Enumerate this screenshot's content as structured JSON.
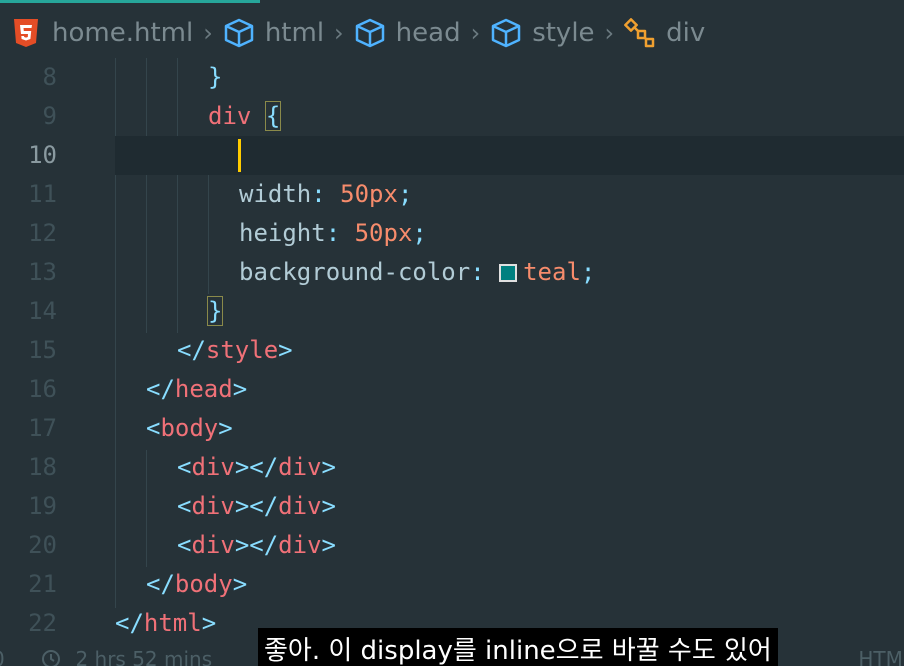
{
  "breadcrumb": {
    "file": "home.html",
    "items": [
      "html",
      "head",
      "style",
      "div"
    ],
    "separator": "›"
  },
  "editor": {
    "current_line": "10",
    "lines": [
      {
        "n": "8"
      },
      {
        "n": "9"
      },
      {
        "n": "10"
      },
      {
        "n": "11"
      },
      {
        "n": "12"
      },
      {
        "n": "13"
      },
      {
        "n": "14"
      },
      {
        "n": "15"
      },
      {
        "n": "16"
      },
      {
        "n": "17"
      },
      {
        "n": "18"
      },
      {
        "n": "19"
      },
      {
        "n": "20"
      },
      {
        "n": "21"
      },
      {
        "n": "22"
      }
    ],
    "tokens": {
      "close_brace": "}",
      "div_selector": "div",
      "open_brace": "{",
      "width_prop": "width",
      "width_val": "50px",
      "height_prop": "height",
      "height_val": "50px",
      "bg_prop": "background-color",
      "bg_val": "teal",
      "colon": ":",
      "semicolon": ";",
      "style_close": "style",
      "head_close": "head",
      "body_open": "body",
      "div_tag": "div",
      "body_close": "body",
      "html_close": "html"
    }
  },
  "status": {
    "left": "0",
    "time": "2 hrs 52 mins",
    "right": "HTML"
  },
  "subtitle": "좋아. 이 display를 inline으로 바꿀 수도 있어",
  "colors": {
    "background": "#263238",
    "accent": "#26a69a",
    "tag": "#f07178",
    "punctuation": "#89ddff",
    "number": "#f78c6c",
    "swatch": "#008080",
    "cursor": "#ffcc00"
  }
}
